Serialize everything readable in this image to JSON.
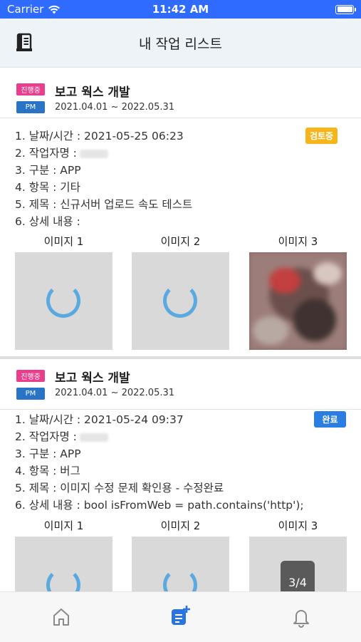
{
  "status_bar": {
    "carrier": "Carrier",
    "time": "11:42 AM"
  },
  "header": {
    "title": "내 작업 리스트"
  },
  "cards": [
    {
      "progress_badge": "진행중",
      "role_badge": "PM",
      "project_title": "보고 웍스 개발",
      "period": "2021.04.01 ~ 2022.05.31",
      "status": {
        "label": "검토중",
        "color": "#f6b61b"
      },
      "details": {
        "datetime": "1. 날짜/시간 : 2021-05-25 06:23",
        "author": "2. 작업자명 :",
        "category": "3. 구분 : APP",
        "item": "4. 항목 : 기타",
        "subject": "5. 제목 : 신규서버 업로드 속도 테스트",
        "description": "6. 상세 내용 :"
      },
      "images": [
        {
          "label": "이미지 1"
        },
        {
          "label": "이미지 2"
        },
        {
          "label": "이미지 3"
        }
      ]
    },
    {
      "progress_badge": "진행중",
      "role_badge": "PM",
      "project_title": "보고 웍스 개발",
      "period": "2021.04.01 ~ 2022.05.31",
      "status": {
        "label": "완료",
        "color": "#2a7de1"
      },
      "details": {
        "datetime": "1. 날짜/시간 : 2021-05-24 09:37",
        "author": "2. 작업자명 :",
        "category": "3. 구분 : APP",
        "item": "4. 항목 : 버그",
        "subject": "5. 제목 : 이미지 수정 문제 확인용 - 수정완료",
        "description": "6. 상세 내용 : bool isFromWeb = path.contains('http');"
      },
      "images": [
        {
          "label": "이미지 1"
        },
        {
          "label": "이미지 2"
        },
        {
          "label": "이미지 3",
          "overlay": "3/4"
        }
      ]
    }
  ],
  "bottom_nav": {
    "items": [
      {
        "icon": "home-icon"
      },
      {
        "icon": "task-add-icon",
        "active": true
      },
      {
        "icon": "bell-icon"
      }
    ],
    "active_color": "#2a74e0",
    "inactive_color": "#8a8a8a"
  }
}
